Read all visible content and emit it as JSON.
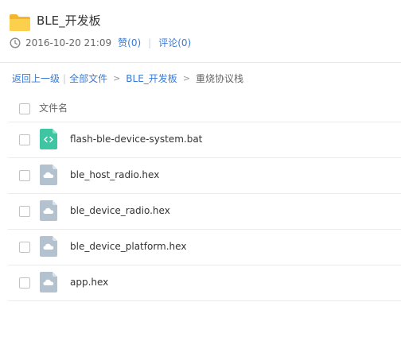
{
  "folder": {
    "icon": "folder-icon",
    "title": "BLE_开发板"
  },
  "meta": {
    "clock_icon": "clock-icon",
    "time": "2016-10-20 21:09",
    "like": "赞(0)",
    "comment": "评论(0)"
  },
  "breadcrumb": {
    "back": "返回上一级",
    "separator": "|",
    "all_files": "全部文件",
    "arrow": ">",
    "parent": "BLE_开发板",
    "current": "重烧协议栈"
  },
  "list": {
    "column_name": "文件名",
    "files": [
      {
        "name": "flash-ble-device-system.bat",
        "icon": "script-file-icon"
      },
      {
        "name": "ble_host_radio.hex",
        "icon": "generic-file-icon"
      },
      {
        "name": "ble_device_radio.hex",
        "icon": "generic-file-icon"
      },
      {
        "name": "ble_device_platform.hex",
        "icon": "generic-file-icon"
      },
      {
        "name": "app.hex",
        "icon": "generic-file-icon"
      }
    ]
  },
  "colors": {
    "link": "#3a7bd5",
    "folder": "#f7c948",
    "script_icon": "#3ec6a3",
    "generic_icon": "#b4c2cf"
  }
}
